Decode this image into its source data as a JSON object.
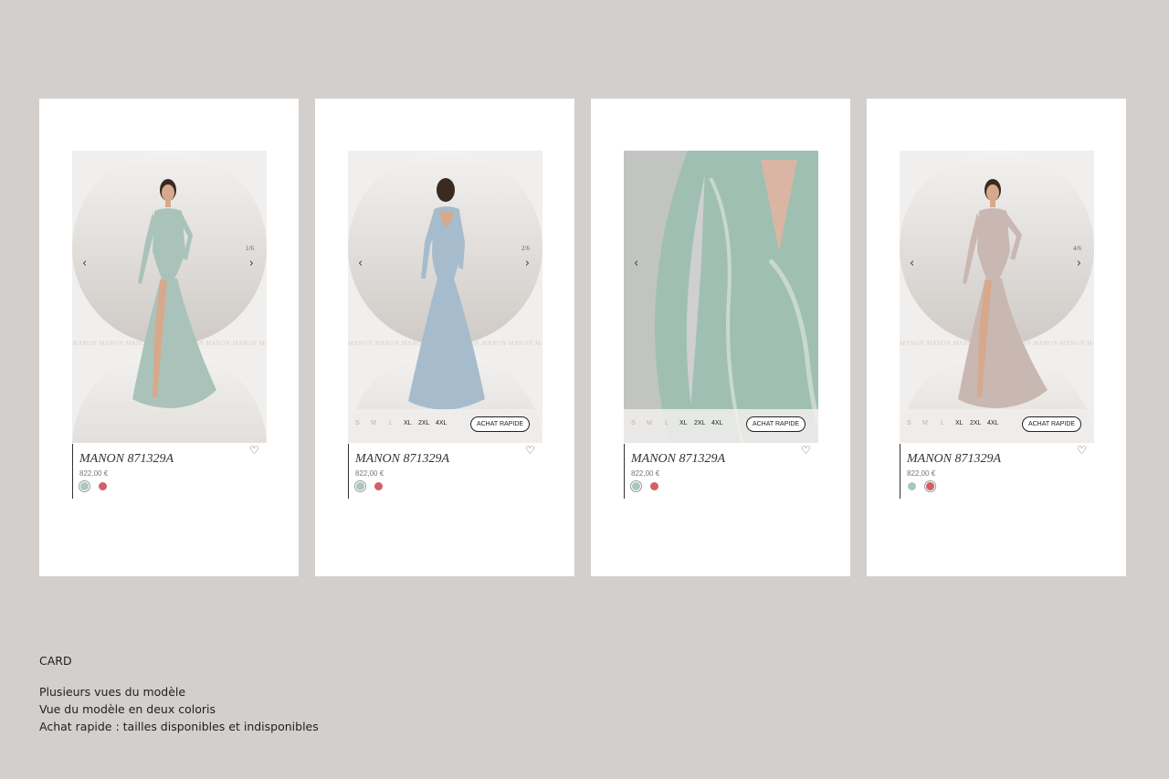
{
  "watermark": "MANON MANON MANON MANON MANON MANON MANON MANON",
  "cards": [
    {
      "counter": "1/6",
      "name": "MANON 871329A",
      "price": "822,00 €",
      "dress_color": "#a9c3bb"
    },
    {
      "counter": "2/6",
      "name": "MANON 871329A",
      "price": "822,00 €",
      "dress_color": "#a6bccd"
    },
    {
      "name": "MANON 871329A",
      "price": "822,00 €",
      "dress_color": "#9fbfb3"
    },
    {
      "counter": "4/6",
      "name": "MANON 871329A",
      "price": "822,00 €",
      "dress_color": "#c9b7b1"
    }
  ],
  "sizes": [
    "S",
    "M",
    "L",
    "XL",
    "2XL",
    "4XL"
  ],
  "quick_buy_label": "ACHAT RAPIDE",
  "swatch_colors": [
    "#a9c8bd",
    "#d06167"
  ],
  "caption": {
    "title": "CARD",
    "lines": [
      "Plusieurs vues du modèle",
      "Vue du modèle en deux coloris",
      "Achat rapide : tailles disponibles et indisponibles"
    ]
  }
}
